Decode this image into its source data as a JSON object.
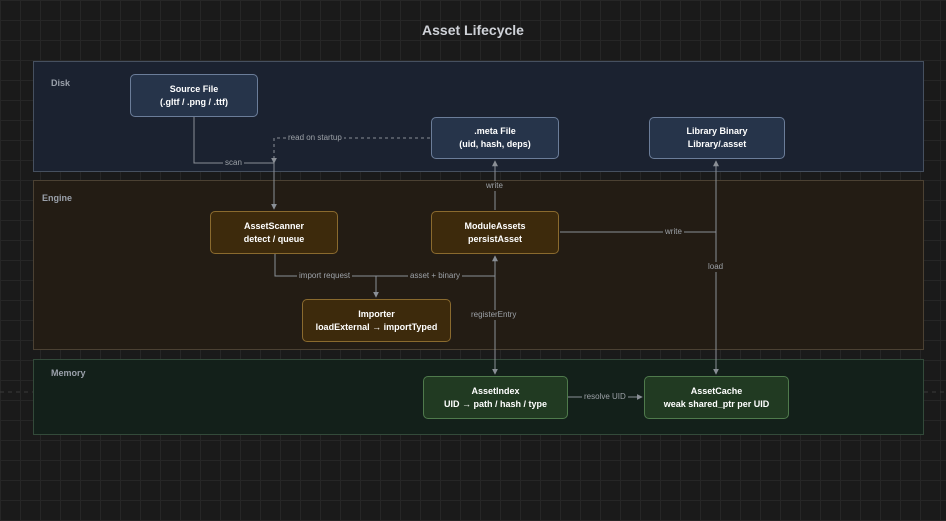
{
  "title": "Asset Lifecycle",
  "lanes": {
    "disk": "Disk",
    "engine": "Engine",
    "memory": "Memory"
  },
  "nodes": {
    "source_file": {
      "line1": "Source File",
      "line2": "(.gltf / .png / .ttf)"
    },
    "meta_file": {
      "line1": ".meta File",
      "line2": "(uid, hash, deps)"
    },
    "library_binary": {
      "line1": "Library Binary",
      "line2": "Library/.asset"
    },
    "asset_scanner": {
      "line1": "AssetScanner",
      "line2": "detect / queue"
    },
    "module_assets": {
      "line1": "ModuleAssets",
      "line2": "persistAsset"
    },
    "importer": {
      "line1": "Importer",
      "line2": "loadExternal → importTyped"
    },
    "asset_index": {
      "line1": "AssetIndex",
      "line2": "UID → path / hash / type"
    },
    "asset_cache": {
      "line1": "AssetCache",
      "line2": "weak shared_ptr per UID"
    }
  },
  "edges": {
    "scan": "scan",
    "read_on_startup": "read on startup",
    "write_meta": "write",
    "write_library": "write",
    "load": "load",
    "import_request": "import request",
    "asset_binary": "asset + binary",
    "register_entry": "registerEntry",
    "resolve_uid": "resolve UID"
  },
  "colors": {
    "edge": "#8a8f96",
    "disk_node": "#26344a",
    "engine_node": "#3d2a0c",
    "memory_node": "#213a22"
  }
}
